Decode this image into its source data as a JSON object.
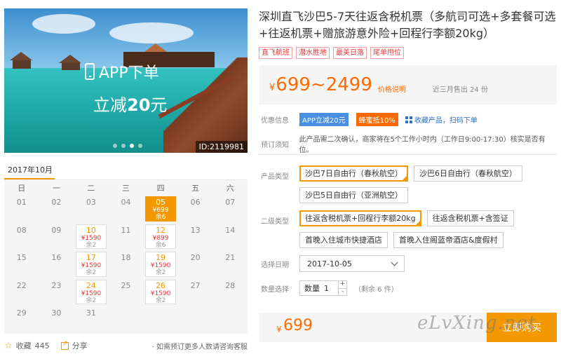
{
  "title": "深圳直飞沙巴5-7天往返含税机票（多航司可选+多套餐可选+往返机票+赠旅游意外险+回程行李额20kg）",
  "tags": [
    "直飞航班",
    "潜水胜地",
    "最美日落",
    "尾单甩位"
  ],
  "hero": {
    "promo_line1": "APP下单",
    "promo_line2_prefix": "立减",
    "promo_line2_amount": "20",
    "promo_line2_suffix": "元",
    "image_id": "ID:2119981",
    "slide_count": 4,
    "active_slide": 3
  },
  "price": {
    "currency": "¥",
    "range": "699~2499",
    "label": "价格说明",
    "sold": "近三月售出 24 份"
  },
  "offers": {
    "label": "优惠信息",
    "badge_app": "APP立减20元",
    "badge_honey": "蜂蜜抵10%",
    "collect": "收藏产品，扫码下单"
  },
  "notice": {
    "label": "预订须知",
    "text": "此产品需二次确认，商家将在5个工作小时内（工作日9:00-17:30）核实是否有位。"
  },
  "product_type": {
    "label": "产品类型",
    "options": [
      "沙巴7日自由行（春秋航空）",
      "沙巴6日自由行（春秋航空）",
      "沙巴5日自由行（亚洲航空）"
    ],
    "selected": 0
  },
  "sub_type": {
    "label": "二级类型",
    "options": [
      "往返含税机票+回程行李额20kg",
      "往返含税机票+含签证",
      "首晚入住城市快捷酒店",
      "首晚入住阁蓝帝酒店&度假村"
    ],
    "selected": 0
  },
  "date": {
    "label": "选择日期",
    "value": "2017-10-05"
  },
  "quantity": {
    "label": "数量选择",
    "field_label": "数量",
    "value": "1",
    "plus": "+",
    "minus": "-",
    "remain": "（剩余 6 件）"
  },
  "buy": {
    "currency": "¥",
    "amount": "699",
    "button": "立即购买"
  },
  "watermark": "eLvXing.net",
  "calendar": {
    "month": "2017年10月",
    "weekdays": [
      "日",
      "一",
      "二",
      "三",
      "四",
      "五",
      "六"
    ],
    "days": [
      {
        "d": "01"
      },
      {
        "d": "02"
      },
      {
        "d": "03"
      },
      {
        "d": "04"
      },
      {
        "d": "05",
        "price": "¥699",
        "remain": "余6",
        "selected": true
      },
      {
        "d": "06"
      },
      {
        "d": "07"
      },
      {
        "d": "08"
      },
      {
        "d": "09"
      },
      {
        "d": "10",
        "price": "¥1590",
        "remain": "余2"
      },
      {
        "d": "11"
      },
      {
        "d": "12",
        "price": "¥899",
        "remain": "余6"
      },
      {
        "d": "13"
      },
      {
        "d": "14"
      },
      {
        "d": "15"
      },
      {
        "d": "16"
      },
      {
        "d": "17",
        "price": "¥1590",
        "remain": "余2"
      },
      {
        "d": "18"
      },
      {
        "d": "19",
        "price": "¥1590",
        "remain": "余2"
      },
      {
        "d": "20"
      },
      {
        "d": "21"
      },
      {
        "d": "22"
      },
      {
        "d": "23"
      },
      {
        "d": "24",
        "price": "¥1590",
        "remain": "余2"
      },
      {
        "d": "25"
      },
      {
        "d": "26",
        "price": "¥1590",
        "remain": "余2"
      },
      {
        "d": "27"
      },
      {
        "d": "28"
      },
      {
        "d": "29"
      },
      {
        "d": "30"
      },
      {
        "d": "31"
      }
    ]
  },
  "footer": {
    "favorite_label": "收藏",
    "favorite_count": "445",
    "share_label": "分享",
    "note": "· 如需预订更多人数请咨询客服"
  },
  "colors": {
    "accent": "#f39800",
    "price": "#ff6a00",
    "link": "#2d6ec9",
    "tag": "#e4393c"
  }
}
